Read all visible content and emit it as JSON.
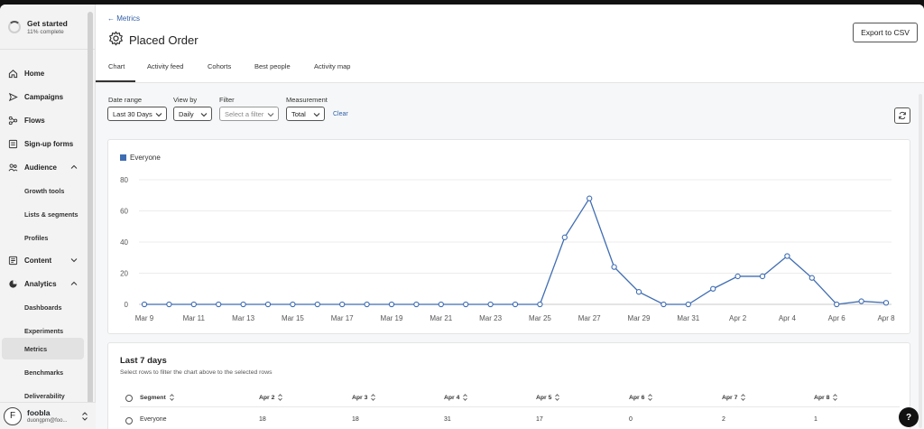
{
  "sidebar": {
    "get_started": {
      "title": "Get started",
      "subtitle": "11% complete"
    },
    "items": [
      {
        "label": "Home",
        "icon": "home-icon"
      },
      {
        "label": "Campaigns",
        "icon": "send-icon"
      },
      {
        "label": "Flows",
        "icon": "flow-icon"
      },
      {
        "label": "Sign-up forms",
        "icon": "form-icon"
      },
      {
        "label": "Audience",
        "icon": "audience-icon"
      },
      {
        "label": "Growth tools"
      },
      {
        "label": "Lists & segments"
      },
      {
        "label": "Profiles"
      },
      {
        "label": "Content",
        "icon": "content-icon"
      },
      {
        "label": "Analytics",
        "icon": "analytics-icon"
      },
      {
        "label": "Dashboards"
      },
      {
        "label": "Experiments"
      },
      {
        "label": "Metrics"
      },
      {
        "label": "Benchmarks"
      },
      {
        "label": "Deliverability"
      }
    ],
    "active": "Metrics",
    "user": {
      "initial": "F",
      "name": "foobla",
      "email": "duongpm@foo..."
    }
  },
  "header": {
    "back_label": "← Metrics",
    "title": "Placed Order",
    "export_label": "Export to CSV",
    "tabs": [
      "Chart",
      "Activity feed",
      "Cohorts",
      "Best people",
      "Activity map"
    ],
    "active_tab": "Chart"
  },
  "filters": {
    "date_range": {
      "label": "Date range",
      "value": "Last 30 Days"
    },
    "view_by": {
      "label": "View by",
      "value": "Daily"
    },
    "filter": {
      "label": "Filter",
      "placeholder": "Select a filter"
    },
    "measurement": {
      "label": "Measurement",
      "value": "Total"
    },
    "clear_label": "Clear"
  },
  "chart_data": {
    "type": "line",
    "series": [
      {
        "name": "Everyone",
        "values": [
          0,
          0,
          0,
          0,
          0,
          0,
          0,
          0,
          0,
          0,
          0,
          0,
          0,
          0,
          0,
          0,
          0,
          43,
          68,
          24,
          8,
          0,
          0,
          10,
          18,
          18,
          31,
          17,
          0,
          2,
          1
        ]
      }
    ],
    "x": [
      "Mar 9",
      "Mar 10",
      "Mar 11",
      "Mar 12",
      "Mar 13",
      "Mar 14",
      "Mar 15",
      "Mar 16",
      "Mar 17",
      "Mar 18",
      "Mar 19",
      "Mar 20",
      "Mar 21",
      "Mar 22",
      "Mar 23",
      "Mar 24",
      "Mar 25",
      "Mar 26",
      "Mar 27",
      "Mar 28",
      "Mar 29",
      "Mar 30",
      "Mar 31",
      "Apr 1",
      "Apr 2",
      "Apr 3",
      "Apr 4",
      "Apr 5",
      "Apr 6",
      "Apr 7",
      "Apr 8"
    ],
    "x_tick_labels": [
      "Mar 9",
      "Mar 11",
      "Mar 13",
      "Mar 15",
      "Mar 17",
      "Mar 19",
      "Mar 21",
      "Mar 23",
      "Mar 25",
      "Mar 27",
      "Mar 29",
      "Mar 31",
      "Apr 2",
      "Apr 4",
      "Apr 6",
      "Apr 8"
    ],
    "y_ticks": [
      0,
      20,
      40,
      60,
      80
    ],
    "ylim": [
      0,
      80
    ],
    "grid": true,
    "legend": "top-left",
    "color": "#3f6db3"
  },
  "table": {
    "title": "Last 7 days",
    "subtitle": "Select rows to filter the chart above to the selected rows",
    "headers": [
      "Segment",
      "Apr 2",
      "Apr 3",
      "Apr 4",
      "Apr 5",
      "Apr 6",
      "Apr 7",
      "Apr 8"
    ],
    "rows": [
      [
        "Everyone",
        "18",
        "18",
        "31",
        "17",
        "0",
        "2",
        "1"
      ]
    ]
  },
  "help_label": "?"
}
